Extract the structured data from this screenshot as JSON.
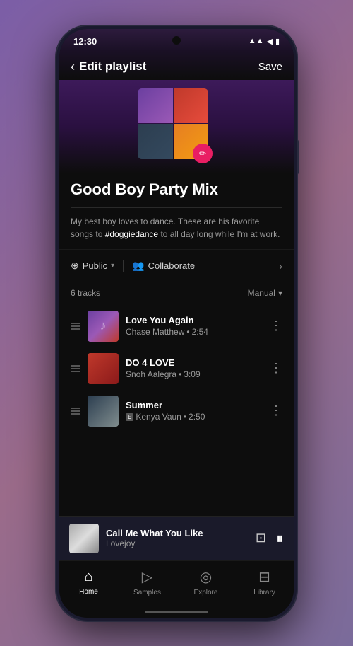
{
  "phone": {
    "status": {
      "time": "12:30",
      "signal_icon": "▲▲",
      "wifi_icon": "▲",
      "battery_icon": "▮"
    },
    "header": {
      "back_label": "<",
      "title": "Edit playlist",
      "save_label": "Save"
    },
    "playlist": {
      "name": "Good Boy Party Mix",
      "description": "My best boy loves to dance. These are his favorite songs to ",
      "hashtag": "#doggiedance",
      "description_end": " to all day long while I'm at work."
    },
    "controls": {
      "visibility": "Public",
      "collaborate": "Collaborate"
    },
    "tracks": {
      "count": "6 tracks",
      "sort": "Manual",
      "items": [
        {
          "name": "Love You Again",
          "artist": "Chase Matthew",
          "duration": "2:54",
          "explicit": false
        },
        {
          "name": "DO 4 LOVE",
          "artist": "Snoh Aalegra",
          "duration": "3:09",
          "explicit": false
        },
        {
          "name": "Summer",
          "artist": "Kenya Vaun",
          "duration": "2:50",
          "explicit": true
        }
      ]
    },
    "now_playing": {
      "title": "Call Me What You Like",
      "artist": "Lovejoy"
    },
    "bottom_nav": {
      "items": [
        {
          "label": "Home",
          "icon": "⌂",
          "active": true
        },
        {
          "label": "Samples",
          "icon": "▷",
          "active": false
        },
        {
          "label": "Explore",
          "icon": "◎",
          "active": false
        },
        {
          "label": "Library",
          "icon": "⊟",
          "active": false
        }
      ]
    }
  }
}
